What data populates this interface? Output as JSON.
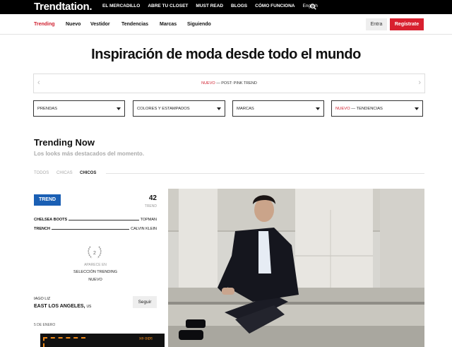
{
  "topbar": {
    "logo": "Trendtation.",
    "links": [
      "EL MERCADILLO",
      "ABRE TU CLOSET",
      "MUST READ",
      "BLOGS",
      "CÓMO FUNCIONA"
    ],
    "language": "English",
    "icon": "search-icon"
  },
  "subnav": {
    "tabs": [
      "Trending",
      "Nuevo",
      "Vestidor",
      "Tendencias",
      "Marcas",
      "Siguiendo"
    ],
    "active_tab": "Trending",
    "login_label": "Entra",
    "register_label": "Regístrate"
  },
  "headline": "Inspiración de moda desde todo el mundo",
  "carousel": {
    "tag": "NUEVO",
    "separator": "—",
    "text": "POST: PINK TREND"
  },
  "filters": [
    {
      "label": "PRENDAS"
    },
    {
      "label": "COLORES Y ESTAMPADOS"
    },
    {
      "label": "MARCAS"
    },
    {
      "tag": "NUEVO",
      "separator": "—",
      "label": "TENDENCIAS"
    }
  ],
  "trending": {
    "title": "Trending Now",
    "subtitle": "Los looks más destacados del momento.",
    "filter_tabs": [
      "TODOS",
      "CHICAS",
      "CHICOS"
    ],
    "active_filter": "CHICOS"
  },
  "look": {
    "badge": "TREND",
    "count": "42",
    "count_label": "TREND",
    "items": [
      {
        "item": "CHELSEA BOOTS",
        "brand": "TOPMAN"
      },
      {
        "item": "TRENCH",
        "brand": "CALVIN KLEIN"
      }
    ],
    "rank": "2",
    "appears_label": "APARECE EN",
    "appears_line1": "SELECCIÓN TRENDING",
    "appears_line2": "NUEVO",
    "author": "IAGO LIZ",
    "location": "EAST LOS ANGELES,",
    "country": "US",
    "follow_label": "Seguir",
    "date": "5 DE ENERO",
    "ad_text": "sdio ex"
  },
  "colors": {
    "accent_red": "#d8202f",
    "trend_blue": "#1a5fb4",
    "topbar": "#000000"
  }
}
